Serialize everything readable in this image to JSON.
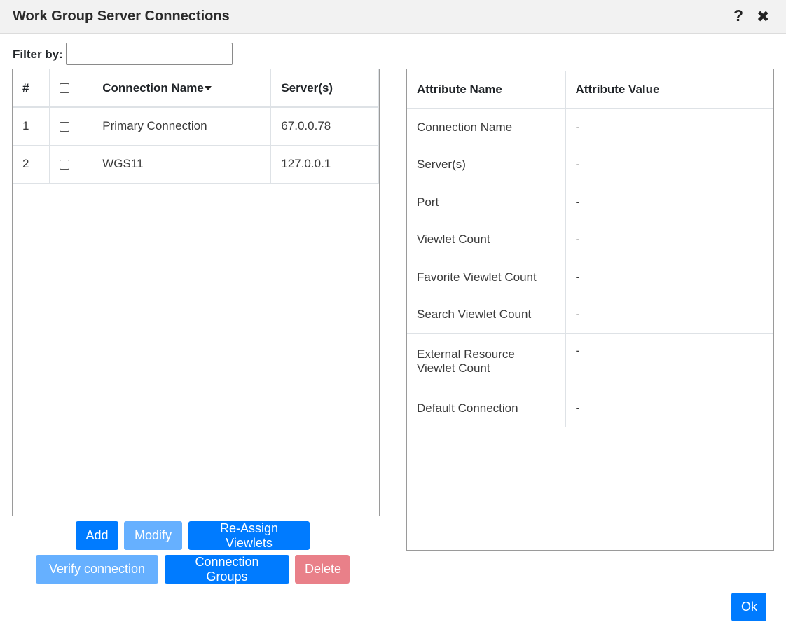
{
  "dialog": {
    "title": "Work Group Server Connections",
    "help_glyph": "?",
    "close_glyph": "✖"
  },
  "filter": {
    "label": "Filter by:",
    "value": "",
    "placeholder": ""
  },
  "connections_table": {
    "columns": {
      "index": "#",
      "name": "Connection Name",
      "servers": "Server(s)"
    },
    "sort": {
      "column": "Connection Name",
      "direction": "descending"
    },
    "rows": [
      {
        "index": "1",
        "checked": false,
        "name": "Primary Connection",
        "servers": "67.0.0.78"
      },
      {
        "index": "2",
        "checked": false,
        "name": "WGS11",
        "servers": "127.0.0.1"
      }
    ]
  },
  "attributes_table": {
    "columns": {
      "name": "Attribute Name",
      "value": "Attribute Value"
    },
    "rows": [
      {
        "name": "Connection Name",
        "value": "-"
      },
      {
        "name": "Server(s)",
        "value": "-"
      },
      {
        "name": "Port",
        "value": "-"
      },
      {
        "name": "Viewlet Count",
        "value": "-"
      },
      {
        "name": "Favorite Viewlet Count",
        "value": "-"
      },
      {
        "name": "Search Viewlet Count",
        "value": "-"
      },
      {
        "name": "External Resource Viewlet Count",
        "value": "-"
      },
      {
        "name": "Default Connection",
        "value": "-"
      }
    ]
  },
  "buttons": {
    "add": "Add",
    "modify": "Modify",
    "reassign": "Re-Assign Viewlets",
    "verify": "Verify connection",
    "groups": "Connection Groups",
    "delete": "Delete",
    "ok": "Ok"
  },
  "colors": {
    "primary": "#007bff",
    "primary_disabled": "#66b0ff",
    "danger_disabled": "#e98089",
    "titlebar_bg": "#f2f2f2"
  },
  "icons": [
    "help-icon",
    "close-icon",
    "sort-descending-icon"
  ]
}
